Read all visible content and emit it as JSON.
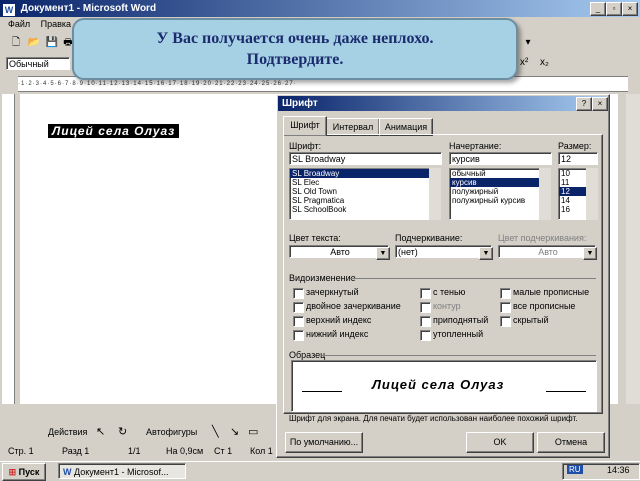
{
  "window": {
    "title": "Документ1 - Microsoft Word"
  },
  "menu": [
    "Файл",
    "Правка"
  ],
  "fmt": {
    "style": "Обычный"
  },
  "tooltip": {
    "line1": "У Вас получается очень даже неплохо.",
    "line2": "Подтвердите."
  },
  "doc": {
    "text": "Лицей села Олуаз"
  },
  "dialog": {
    "title": "Шрифт",
    "help": "?",
    "close": "×",
    "tabs": [
      "Шрифт",
      "Интервал",
      "Анимация"
    ],
    "font_label": "Шрифт:",
    "font_value": "SL Broadway",
    "font_list": [
      "SL Broadway",
      "SL Elec",
      "SL Old Town",
      "SL Pragmatica",
      "SL SchoolBook"
    ],
    "style_label": "Начертание:",
    "style_value": "курсив",
    "style_list": [
      "обычный",
      "курсив",
      "полужирный",
      "полужирный курсив"
    ],
    "size_label": "Размер:",
    "size_value": "12",
    "size_list": [
      "10",
      "11",
      "12",
      "14",
      "16"
    ],
    "color_label": "Цвет текста:",
    "color_value": "Авто",
    "underline_label": "Подчеркивание:",
    "underline_value": "(нет)",
    "ucolor_label": "Цвет подчеркивания:",
    "ucolor_value": "Авто",
    "effects_label": "Видоизменение",
    "effects_col1": [
      "зачеркнутый",
      "двойное зачеркивание",
      "верхний индекс",
      "нижний индекс"
    ],
    "effects_col2": [
      "с тенью",
      "контур",
      "приподнятый",
      "утопленный"
    ],
    "effects_col3": [
      "малые прописные",
      "все прописные",
      "скрытый"
    ],
    "sample_label": "Образец",
    "sample_text": "Лицей села Олуаз",
    "note": "Шрифт для экрана. Для печати будет использован наиболее похожий шрифт.",
    "default_btn": "По умолчанию...",
    "ok_btn": "OK",
    "cancel_btn": "Отмена"
  },
  "drawbar": {
    "actions": "Действия",
    "autoshapes": "Автофигуры"
  },
  "status": {
    "page": "Стр. 1",
    "section": "Разд 1",
    "pages": "1/1",
    "at": "На 0,9см",
    "line": "Ст 1",
    "col": "Кол 1"
  },
  "taskbar": {
    "start": "Пуск",
    "task": "Документ1 - Microsof...",
    "lang": "RU",
    "clock": "14:36"
  }
}
